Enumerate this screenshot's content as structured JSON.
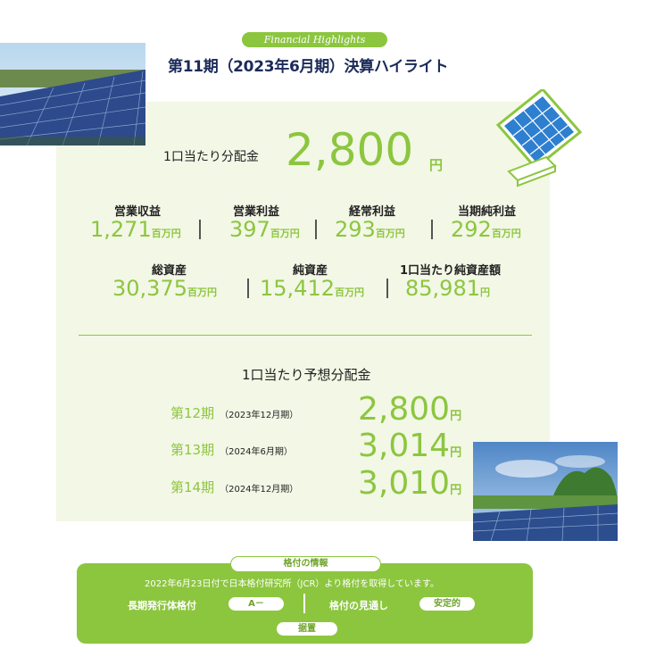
{
  "header": {
    "badge": "Financial Highlights",
    "title": "第11期（2023年6月期）決算ハイライト"
  },
  "distribution": {
    "label": "1口当たり分配金",
    "value": "2,800",
    "unit": "円"
  },
  "metrics_row1": [
    {
      "label": "営業収益",
      "value": "1,271",
      "unit": "百万円"
    },
    {
      "label": "営業利益",
      "value": "397",
      "unit": "百万円"
    },
    {
      "label": "経常利益",
      "value": "293",
      "unit": "百万円"
    },
    {
      "label": "当期純利益",
      "value": "292",
      "unit": "百万円"
    }
  ],
  "metrics_row2": [
    {
      "label": "総資産",
      "value": "30,375",
      "unit": "百万円"
    },
    {
      "label": "純資産",
      "value": "15,412",
      "unit": "百万円"
    },
    {
      "label": "1口当たり純資産額",
      "value": "85,981",
      "unit": "円"
    }
  ],
  "forecast": {
    "title": "1口当たり予想分配金",
    "rows": [
      {
        "period": "第12期",
        "sub": "（2023年12月期）",
        "value": "2,800",
        "unit": "円"
      },
      {
        "period": "第13期",
        "sub": "（2024年6月期）",
        "value": "3,014",
        "unit": "円"
      },
      {
        "period": "第14期",
        "sub": "（2024年12月期）",
        "value": "3,010",
        "unit": "円"
      }
    ]
  },
  "rating": {
    "title": "格付の情報",
    "note": "2022年6月23日付で日本格付研究所（JCR）より格付を取得しています。",
    "long_term_label": "長期発行体格付",
    "long_term_value": "A－",
    "outlook_label": "格付の見通し",
    "outlook_value": "安定的",
    "status": "据置"
  },
  "colors": {
    "accent_green": "#8cc63f",
    "title_navy": "#1b2a59",
    "panel_bg": "#f3f7e6"
  }
}
